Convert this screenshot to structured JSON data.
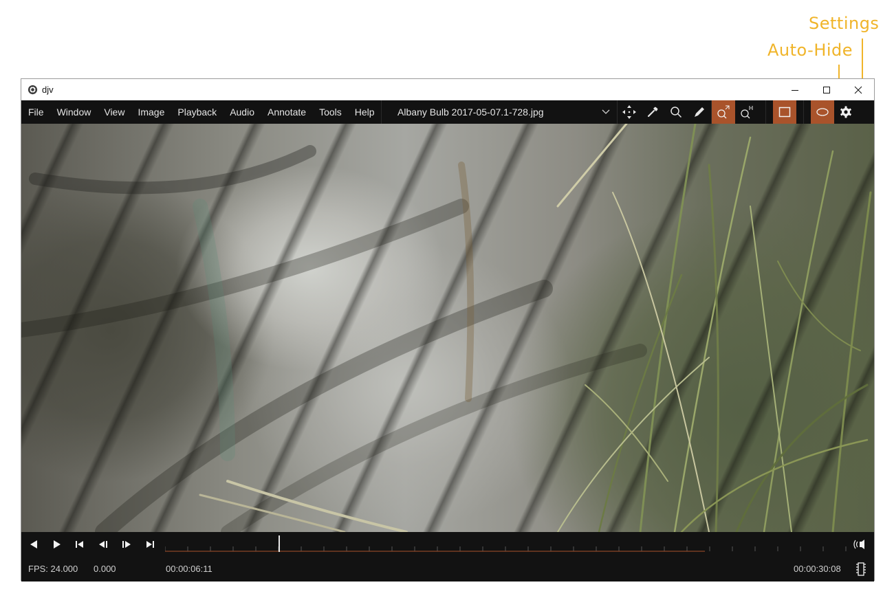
{
  "callouts": {
    "settings": "Settings",
    "auto_hide": "Auto-Hide"
  },
  "window": {
    "title": "djv",
    "controls": {
      "minimize": "–",
      "maximize": "☐",
      "close": "✕"
    }
  },
  "menu": {
    "items": [
      "File",
      "Window",
      "View",
      "Image",
      "Playback",
      "Audio",
      "Annotate",
      "Tools",
      "Help"
    ],
    "file_name": "Albany Bulb 2017-05-07.1-728.jpg"
  },
  "toolbar": {
    "icons": [
      "move-icon",
      "color-picker-icon",
      "magnifier-icon",
      "pencil-icon",
      "zoom-fit-icon",
      "zoom-reset-icon",
      "frame-icon",
      "auto-hide-icon",
      "settings-icon"
    ],
    "active": [
      "zoom-fit-icon",
      "frame-icon",
      "auto-hide-icon"
    ],
    "accent_color": "#a9532b",
    "callout_color": "#f0b429"
  },
  "playback": {
    "current_time": "00:00:06:11",
    "end_time": "00:00:30:08",
    "fps": "FPS: 24.000",
    "speed_value": "0.000",
    "progress": 0.21
  }
}
